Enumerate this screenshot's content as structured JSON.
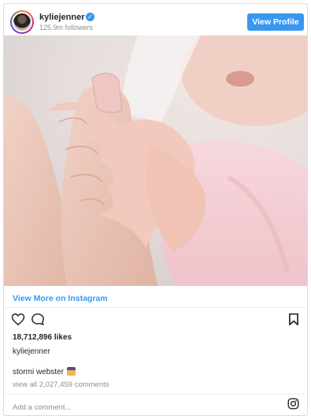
{
  "header": {
    "username": "kyliejenner",
    "verified_icon": "verified-badge-icon",
    "followers": "125.9m followers",
    "view_profile_label": "View Profile"
  },
  "photo": {
    "description_icon": "photo"
  },
  "view_more_label": "View More on Instagram",
  "actions": {
    "like_icon": "heart-outline-icon",
    "comment_icon": "comment-bubble-icon",
    "save_icon": "bookmark-icon"
  },
  "likes": "18,712,896 likes",
  "owner": "kyliejenner",
  "caption": {
    "username": "stormi webster",
    "emoji": "emoji"
  },
  "view_all_comments": "view all 2,027,459 comments",
  "comment_placeholder": "Add a comment...",
  "footer_icon": "instagram-logo-icon",
  "colors": {
    "accent": "#3897f0",
    "text": "#262626",
    "muted": "#8e8e8e",
    "border": "#dbdbdb"
  }
}
